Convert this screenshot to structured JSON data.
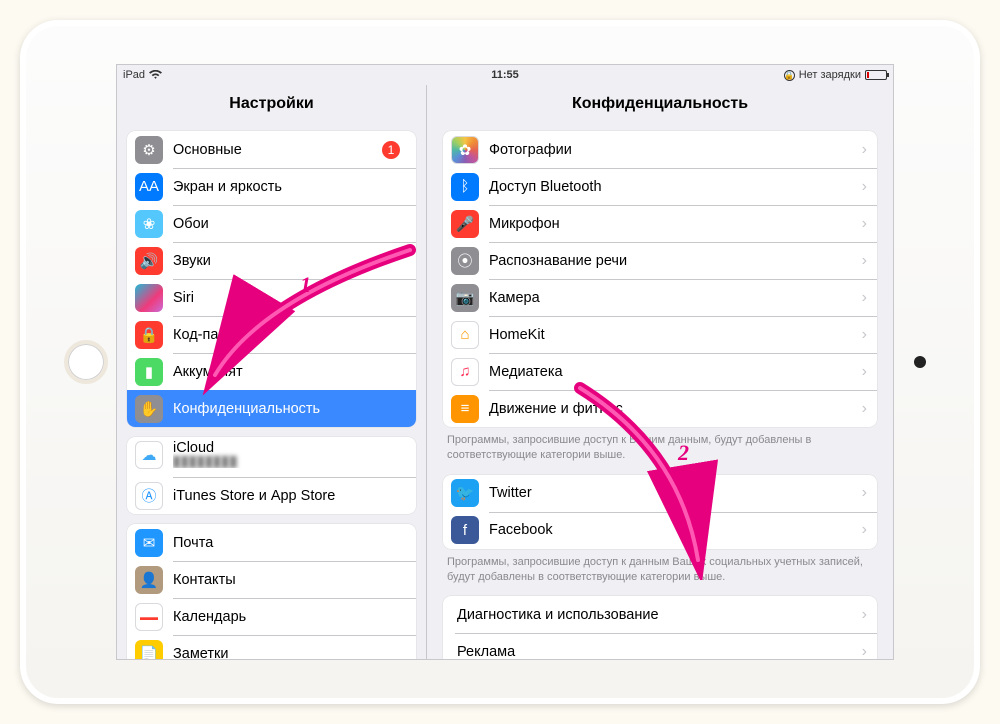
{
  "status": {
    "device": "iPad",
    "time": "11:55",
    "battery_text": "Нет зарядки"
  },
  "sidebar": {
    "title": "Настройки",
    "groups": [
      [
        {
          "key": "general",
          "label": "Основные",
          "icon": "ic-general",
          "glyph": "⚙",
          "badge": "1"
        },
        {
          "key": "display",
          "label": "Экран и яркость",
          "icon": "ic-display",
          "glyph": "AA"
        },
        {
          "key": "wallpaper",
          "label": "Обои",
          "icon": "ic-wall",
          "glyph": "❀"
        },
        {
          "key": "sounds",
          "label": "Звуки",
          "icon": "ic-sound",
          "glyph": "🔊"
        },
        {
          "key": "siri",
          "label": "Siri",
          "icon": "ic-siri",
          "glyph": ""
        },
        {
          "key": "passcode",
          "label": "Код-пароль",
          "icon": "ic-code",
          "glyph": "🔒"
        },
        {
          "key": "battery",
          "label": "Аккумулят",
          "icon": "ic-battery",
          "glyph": "▮"
        },
        {
          "key": "privacy",
          "label": "Конфиденциальность",
          "icon": "ic-privacy",
          "glyph": "✋",
          "selected": true
        }
      ],
      [
        {
          "key": "icloud",
          "label": "iCloud",
          "icon": "ic-icloud",
          "glyph": "☁",
          "sub": "████████"
        },
        {
          "key": "store",
          "label": "iTunes Store и App Store",
          "icon": "ic-store",
          "glyph": "Ⓐ"
        }
      ],
      [
        {
          "key": "mail",
          "label": "Почта",
          "icon": "ic-mail",
          "glyph": "✉"
        },
        {
          "key": "contacts",
          "label": "Контакты",
          "icon": "ic-contacts",
          "glyph": "👤"
        },
        {
          "key": "calendar",
          "label": "Календарь",
          "icon": "ic-cal",
          "glyph": "📅"
        },
        {
          "key": "notes",
          "label": "Заметки",
          "icon": "ic-notes",
          "glyph": "📄"
        }
      ]
    ]
  },
  "detail": {
    "title": "Конфиденциальность",
    "group1": [
      {
        "key": "photos",
        "label": "Фотографии",
        "icon": "ic-photos",
        "glyph": "✿"
      },
      {
        "key": "bluetooth",
        "label": "Доступ Bluetooth",
        "icon": "ic-bt",
        "glyph": "ᛒ"
      },
      {
        "key": "microphone",
        "label": "Микрофон",
        "icon": "ic-mic",
        "glyph": "🎤"
      },
      {
        "key": "speech",
        "label": "Распознавание речи",
        "icon": "ic-speech",
        "glyph": "⦿"
      },
      {
        "key": "camera",
        "label": "Камера",
        "icon": "ic-cam",
        "glyph": "📷"
      },
      {
        "key": "homekit",
        "label": "HomeKit",
        "icon": "ic-home",
        "glyph": "⌂"
      },
      {
        "key": "media",
        "label": "Медиатека",
        "icon": "ic-media",
        "glyph": "♫"
      },
      {
        "key": "motion",
        "label": "Движение и фитнес",
        "icon": "ic-motion",
        "glyph": "≡"
      }
    ],
    "note1": "Программы, запросившие доступ к Вашим данным, будут добавлены в соответствующие категории выше.",
    "group2": [
      {
        "key": "twitter",
        "label": "Twitter",
        "icon": "ic-tw",
        "glyph": "🐦"
      },
      {
        "key": "facebook",
        "label": "Facebook",
        "icon": "ic-fb",
        "glyph": "f"
      }
    ],
    "note2": "Программы, запросившие доступ к данным Ваших социальных учетных записей, будут добавлены в соответствующие категории выше.",
    "group3": [
      {
        "key": "diag",
        "label": "Диагностика и использование"
      },
      {
        "key": "ads",
        "label": "Реклама"
      }
    ]
  },
  "annotations": {
    "num1": "1",
    "num2": "2"
  }
}
